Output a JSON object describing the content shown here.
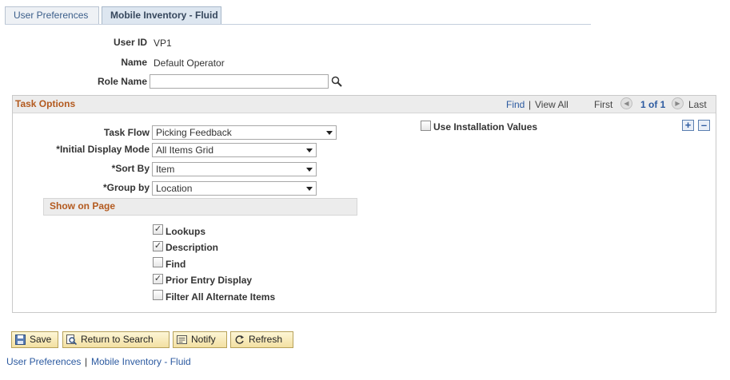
{
  "tabs": [
    {
      "label": "User Preferences",
      "active": false
    },
    {
      "label": "Mobile Inventory - Fluid",
      "active": true
    }
  ],
  "form": {
    "user_id_label": "User ID",
    "user_id_value": "VP1",
    "name_label": "Name",
    "name_value": "Default Operator",
    "role_name_label": "Role Name",
    "role_name_value": ""
  },
  "task_options": {
    "title": "Task Options",
    "nav": {
      "find": "Find",
      "separator": "|",
      "view_all": "View All",
      "first": "First",
      "range": "1 of 1",
      "last": "Last"
    },
    "use_installation_values_label": "Use Installation Values",
    "use_installation_values_checked": false,
    "task_flow_label": "Task Flow",
    "task_flow_value": "Picking Feedback",
    "initial_display_mode_label": "*Initial Display Mode",
    "initial_display_mode_value": "All Items Grid",
    "sort_by_label": "*Sort By",
    "sort_by_value": "Item",
    "group_by_label": "*Group by",
    "group_by_value": "Location",
    "show_on_page": {
      "title": "Show on Page",
      "options": [
        {
          "label": "Lookups",
          "checked": true
        },
        {
          "label": "Description",
          "checked": true
        },
        {
          "label": "Find",
          "checked": false
        },
        {
          "label": "Prior Entry Display",
          "checked": true
        },
        {
          "label": "Filter All Alternate Items",
          "checked": false
        }
      ]
    }
  },
  "toolbar": {
    "save_label": "Save",
    "return_label": "Return to Search",
    "notify_label": "Notify",
    "refresh_label": "Refresh"
  },
  "footer": {
    "link1": "User Preferences",
    "separator": "|",
    "link2": "Mobile Inventory - Fluid"
  },
  "colors": {
    "section_title": "#b35a1f",
    "link": "#2c5aa0",
    "button_bg": "#f3e0a2"
  }
}
